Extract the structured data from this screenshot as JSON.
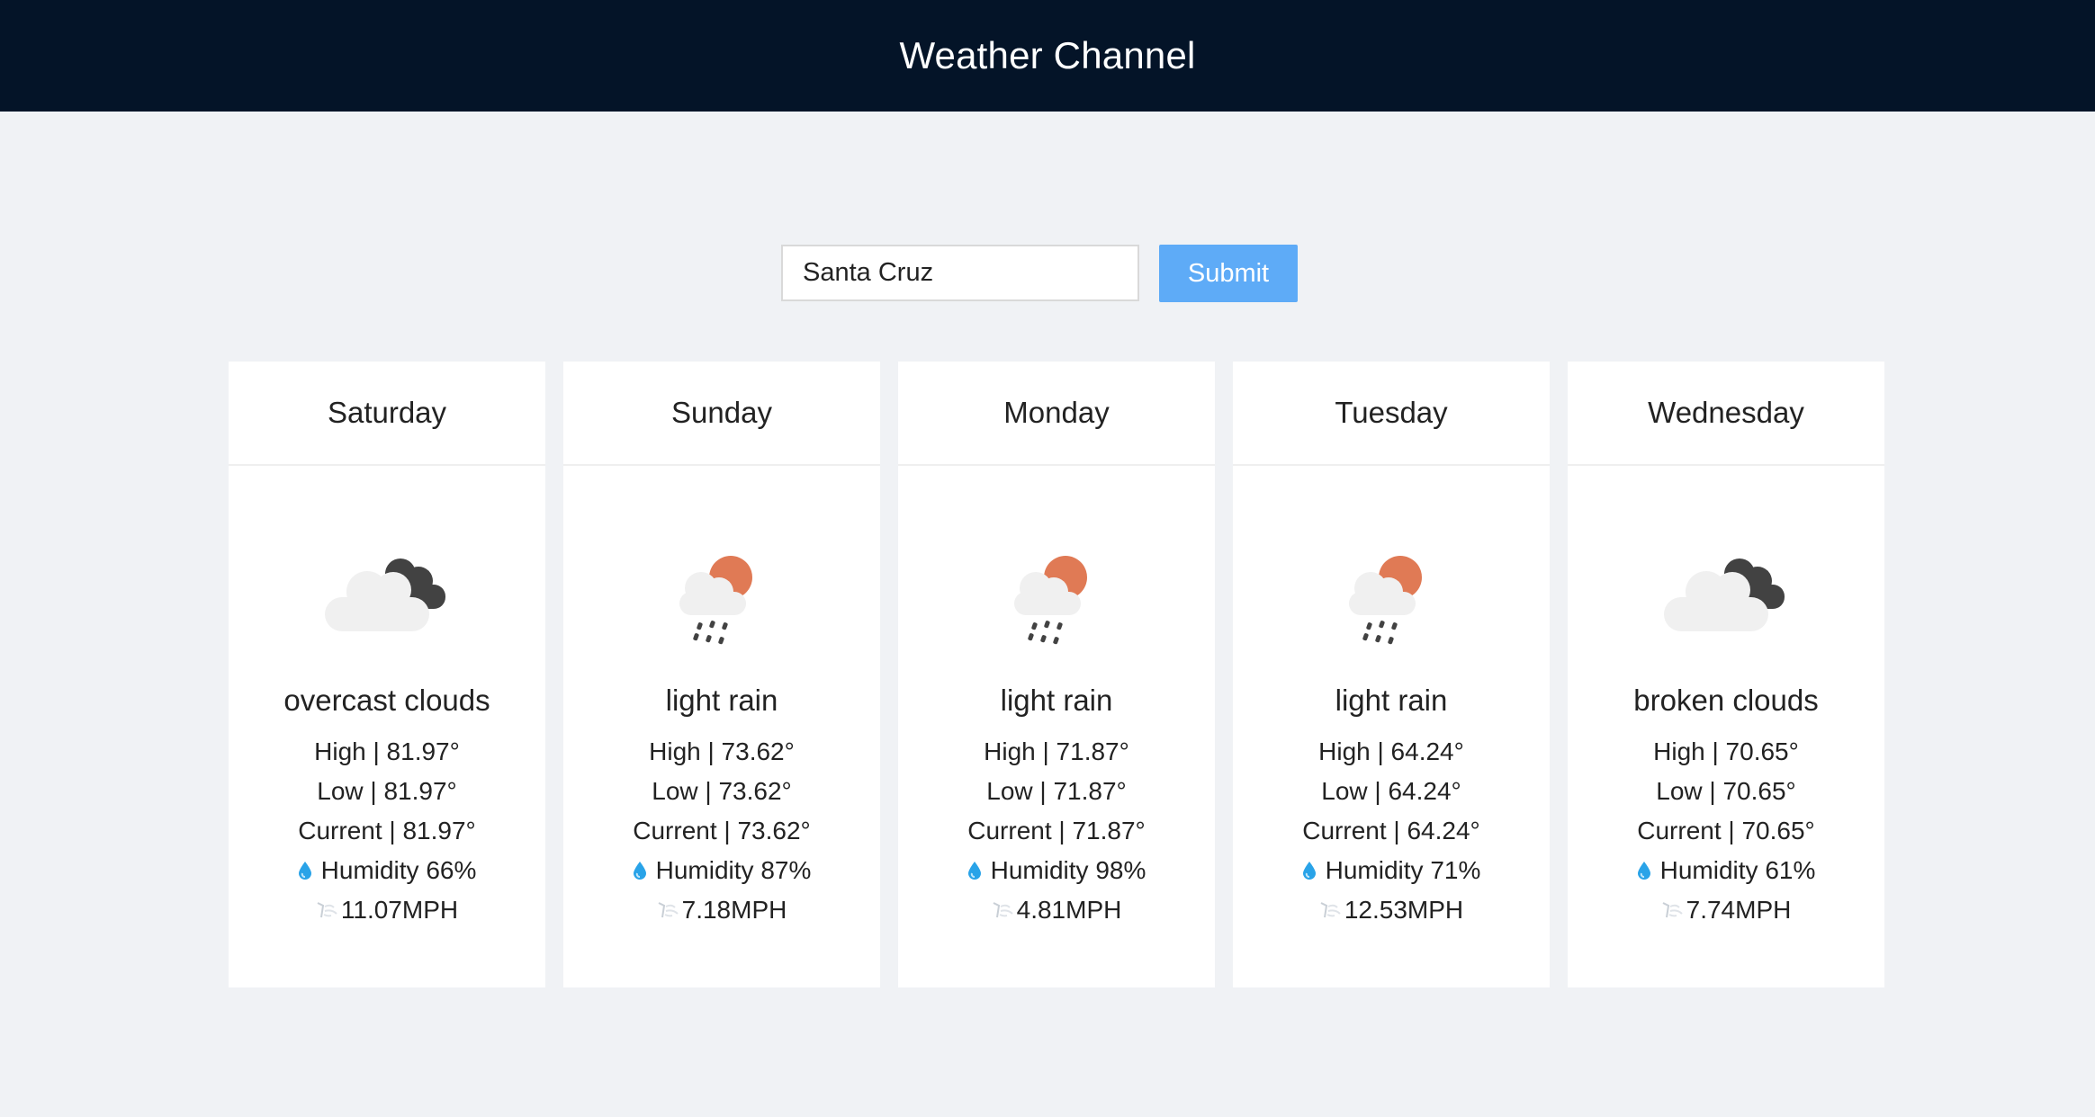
{
  "header": {
    "title": "Weather Channel"
  },
  "search": {
    "value": "Santa Cruz",
    "submit_label": "Submit"
  },
  "days": [
    {
      "day": "Saturday",
      "icon": "overcast-clouds-icon",
      "description": "overcast clouds",
      "high": "High | 81.97°",
      "low": "Low | 81.97°",
      "current": "Current | 81.97°",
      "humidity": "Humidity 66%",
      "wind": "11.07MPH"
    },
    {
      "day": "Sunday",
      "icon": "light-rain-icon",
      "description": "light rain",
      "high": "High | 73.62°",
      "low": "Low | 73.62°",
      "current": "Current | 73.62°",
      "humidity": "Humidity 87%",
      "wind": "7.18MPH"
    },
    {
      "day": "Monday",
      "icon": "light-rain-icon",
      "description": "light rain",
      "high": "High | 71.87°",
      "low": "Low | 71.87°",
      "current": "Current | 71.87°",
      "humidity": "Humidity 98%",
      "wind": "4.81MPH"
    },
    {
      "day": "Tuesday",
      "icon": "light-rain-icon",
      "description": "light rain",
      "high": "High | 64.24°",
      "low": "Low | 64.24°",
      "current": "Current | 64.24°",
      "humidity": "Humidity 71%",
      "wind": "12.53MPH"
    },
    {
      "day": "Wednesday",
      "icon": "broken-clouds-icon",
      "description": "broken clouds",
      "high": "High | 70.65°",
      "low": "Low | 70.65°",
      "current": "Current | 70.65°",
      "humidity": "Humidity 61%",
      "wind": "7.74MPH"
    }
  ],
  "colors": {
    "header_bg": "#041428",
    "page_bg": "#f0f2f5",
    "submit_bg": "#5eabf7",
    "sun": "#e07a55",
    "dark_cloud": "#424242",
    "light_cloud": "#f0f0f0",
    "drop": "#29a3e8"
  }
}
